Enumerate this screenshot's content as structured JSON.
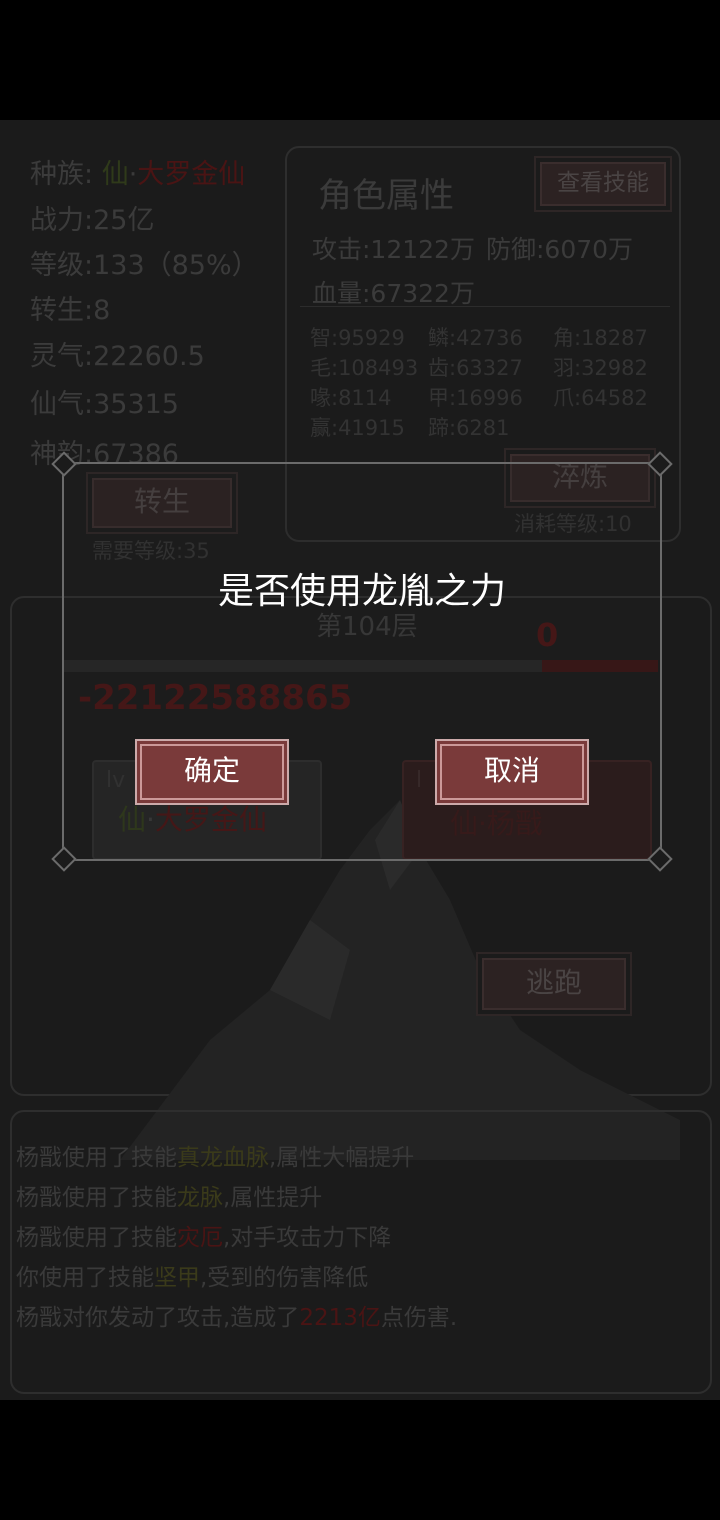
{
  "character": {
    "race_label": "种族:",
    "race_type": "仙",
    "race_sep": "·",
    "race_rank": "大罗金仙",
    "power": "战力:25亿",
    "level": "等级:133（85%）",
    "rebirth": "转生:8",
    "lingqi": "灵气:22260.5",
    "xianqi": "仙气:35315",
    "shenyun": "神韵:67386",
    "rebirth_button": "转生",
    "rebirth_req": "需要等级:35"
  },
  "attributes": {
    "title": "角色属性",
    "view_skills_button": "查看技能",
    "attack": "攻击:12122万",
    "defense": "防御:6070万",
    "hp": "血量:67322万",
    "grid": [
      [
        "智:95929",
        "鳞:42736",
        "角:18287"
      ],
      [
        "毛:108493",
        "齿:63327",
        "羽:32982"
      ],
      [
        "喙:8114",
        "甲:16996",
        "爪:64582"
      ],
      [
        "赢:41915",
        "蹄:6281",
        ""
      ]
    ],
    "temper_button": "淬炼",
    "temper_cost": "消耗等级:10"
  },
  "battle": {
    "floor": "第104层",
    "enemy_hp": "0",
    "damage_text": "-22122588865",
    "player_lv": "lv",
    "player_name_type": "仙",
    "player_name_sep": "·",
    "player_name_rank": "大罗金仙",
    "enemy_lv": "l",
    "enemy_name": "仙·杨戬",
    "flee_button": "逃跑"
  },
  "log": [
    {
      "pre": "杨戬使用了技能",
      "hl": "真龙血脉",
      "post": ",属性大幅提升",
      "hl_color": "y"
    },
    {
      "pre": "杨戬使用了技能",
      "hl": "龙脉",
      "post": ",属性提升",
      "hl_color": "y"
    },
    {
      "pre": "杨戬使用了技能",
      "hl": "灾厄",
      "post": ",对手攻击力下降",
      "hl_color": "r"
    },
    {
      "pre": "你使用了技能",
      "hl": "坚甲",
      "post": ",受到的伤害降低",
      "hl_color": "y"
    },
    {
      "pre": "杨戬对你发动了攻击,造成了",
      "hl": "2213亿",
      "post": "点伤害.",
      "hl_color": "r"
    }
  ],
  "modal": {
    "title": "是否使用龙胤之力",
    "confirm": "确定",
    "cancel": "取消"
  },
  "colors": {
    "accent_red": "#7a3a3a",
    "modal_border": "#6b6b6b"
  }
}
